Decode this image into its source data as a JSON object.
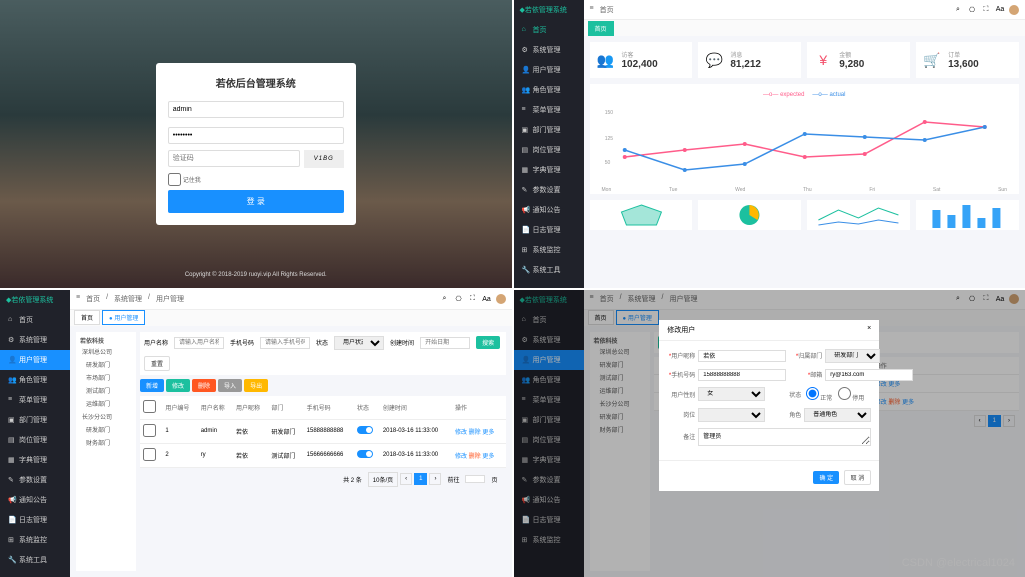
{
  "brand": "若依管理系统",
  "login": {
    "title": "若依后台管理系统",
    "username": "admin",
    "password": "********",
    "captcha_ph": "验证码",
    "captcha_text": "V1BG",
    "remember": "记住我",
    "submit": "登 录"
  },
  "copyright": "Copyright © 2018-2019 ruoyi.vip All Rights Reserved.",
  "sidebar": {
    "items": [
      {
        "label": "首页",
        "icon": "home"
      },
      {
        "label": "系统管理",
        "icon": "gear"
      },
      {
        "label": "用户管理",
        "icon": "user"
      },
      {
        "label": "角色管理",
        "icon": "users"
      },
      {
        "label": "菜单管理",
        "icon": "menu"
      },
      {
        "label": "部门管理",
        "icon": "dept"
      },
      {
        "label": "岗位管理",
        "icon": "post"
      },
      {
        "label": "字典管理",
        "icon": "dict"
      },
      {
        "label": "参数设置",
        "icon": "param"
      },
      {
        "label": "通知公告",
        "icon": "notice"
      },
      {
        "label": "日志管理",
        "icon": "log"
      },
      {
        "label": "系统监控",
        "icon": "monitor"
      },
      {
        "label": "系统工具",
        "icon": "tool"
      }
    ]
  },
  "topbar": {
    "home": "首页",
    "breadcrumb": [
      "首页",
      "系统管理",
      "用户管理"
    ],
    "icons": [
      "search",
      "github",
      "fullscreen",
      "lock",
      "user"
    ]
  },
  "tabs": {
    "home": "首页",
    "user": "用户管理"
  },
  "dashboard": {
    "stats": [
      {
        "label": "访客",
        "value": "102,400",
        "color": "#1cc09f",
        "glyph": "👤"
      },
      {
        "label": "消息",
        "value": "81,212",
        "color": "#36a3f7",
        "glyph": "💬"
      },
      {
        "label": "金额",
        "value": "9,280",
        "color": "#f4516c",
        "glyph": "¥"
      },
      {
        "label": "订单",
        "value": "13,600",
        "color": "#34bfa3",
        "glyph": "🛒"
      }
    ],
    "legend": [
      "expected",
      "actual"
    ],
    "xlabels": [
      "Mon",
      "Tue",
      "Wed",
      "Thu",
      "Fri",
      "Sat",
      "Sun"
    ],
    "chart_data": {
      "type": "line",
      "categories": [
        "Mon",
        "Tue",
        "Wed",
        "Thu",
        "Fri",
        "Sat",
        "Sun"
      ],
      "series": [
        {
          "name": "expected",
          "values": [
            110,
            120,
            130,
            110,
            115,
            155,
            150
          ],
          "color": "#ff5c8a"
        },
        {
          "name": "actual",
          "values": [
            120,
            85,
            95,
            140,
            135,
            130,
            150
          ],
          "color": "#3a8ee6"
        }
      ],
      "ylim": [
        50,
        175
      ]
    }
  },
  "userPage": {
    "tree": {
      "root": "若依科技",
      "children": [
        "深圳总公司",
        "研发部门",
        "市场部门",
        "测试部门",
        "运维部门",
        "长沙分公司",
        "研发部门",
        "财务部门"
      ]
    },
    "filters": {
      "f1": "用户名称",
      "f1ph": "请输入用户名称",
      "f2": "手机号码",
      "f2ph": "请输入手机号码",
      "f3": "状态",
      "f3ph": "用户状态",
      "f4": "创建时间",
      "f4ph": "开始日期",
      "search": "搜索",
      "reset": "重置"
    },
    "actions": [
      "新增",
      "修改",
      "删除",
      "导入",
      "导出"
    ],
    "columns": [
      "",
      "用户编号",
      "用户名称",
      "用户昵称",
      "部门",
      "手机号码",
      "状态",
      "创建时间",
      "操作"
    ],
    "rows": [
      {
        "id": "1",
        "name": "admin",
        "nick": "若依",
        "dept": "研发部门",
        "phone": "15888888888",
        "status": true,
        "time": "2018-03-16 11:33:00",
        "ops": [
          "修改",
          "删除",
          "更多"
        ]
      },
      {
        "id": "2",
        "name": "ry",
        "nick": "若依",
        "dept": "测试部门",
        "phone": "15666666666",
        "status": true,
        "time": "2018-03-16 11:33:00",
        "ops": [
          "修改",
          "删除",
          "更多"
        ]
      }
    ],
    "pager": {
      "total": "共 2 条",
      "perpage": "10条/页",
      "page": "1",
      "goto": "前往",
      "pg": "页"
    }
  },
  "modal": {
    "title": "修改用户",
    "fields": {
      "nick": {
        "label": "用户昵称",
        "value": "若依"
      },
      "dept": {
        "label": "归属部门",
        "value": "研发部门"
      },
      "phone": {
        "label": "手机号码",
        "value": "15888888888"
      },
      "email": {
        "label": "邮箱",
        "value": "ry@163.com"
      },
      "sex": {
        "label": "用户性别",
        "value": "女"
      },
      "status": {
        "label": "状态",
        "opts": [
          "正常",
          "停用"
        ]
      },
      "post": {
        "label": "岗位",
        "value": ""
      },
      "role": {
        "label": "角色",
        "value": "普通角色"
      },
      "remark": {
        "label": "备注",
        "value": "管理员"
      }
    },
    "ok": "确 定",
    "cancel": "取 消"
  },
  "watermark": "CSDN @electrical1024"
}
